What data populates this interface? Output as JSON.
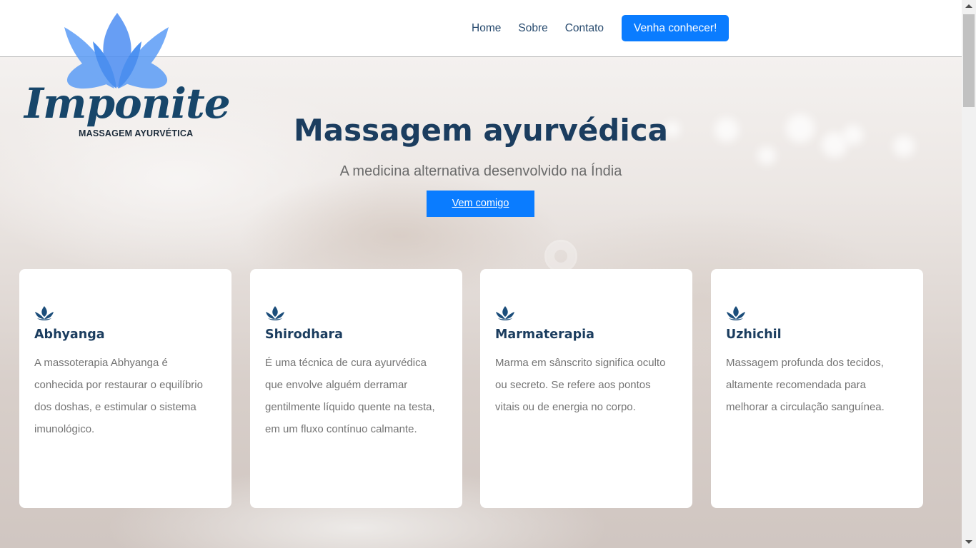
{
  "brand": {
    "logo_text": "Imponite",
    "logo_tagline": "MASSAGEM AYURVÉTICA"
  },
  "nav": {
    "items": [
      "Home",
      "Sobre",
      "Contato"
    ],
    "cta_label": "Venha conhecer!"
  },
  "hero": {
    "title": "Massagem ayurvédica",
    "subtitle": "A medicina alternativa desenvolvido na Índia",
    "button_label": "Vem comigo"
  },
  "cards": [
    {
      "icon": "lotus-icon",
      "title": "Abhyanga",
      "text": "A massoterapia Abhyanga é conhecida por restaurar o equilíbrio dos doshas, e estimular o sistema imunológico."
    },
    {
      "icon": "lotus-icon",
      "title": "Shirodhara",
      "text": "É uma técnica de cura ayurvédica que envolve alguém derramar gentilmente líquido quente na testa, em um fluxo contínuo calmante."
    },
    {
      "icon": "lotus-icon",
      "title": "Marmaterapia",
      "text": "Marma em sânscrito significa oculto ou secreto. Se refere aos pontos vitais ou de energia no corpo."
    },
    {
      "icon": "lotus-icon",
      "title": "Uzhichil",
      "text": "Massagem profunda dos tecidos, altamente recomendada para melhorar a circulação sanguínea."
    }
  ],
  "colors": {
    "accent": "#0a7cff",
    "heading": "#1b3d5f",
    "body_text": "#747474",
    "logo_petal": "#5b9cf6"
  }
}
